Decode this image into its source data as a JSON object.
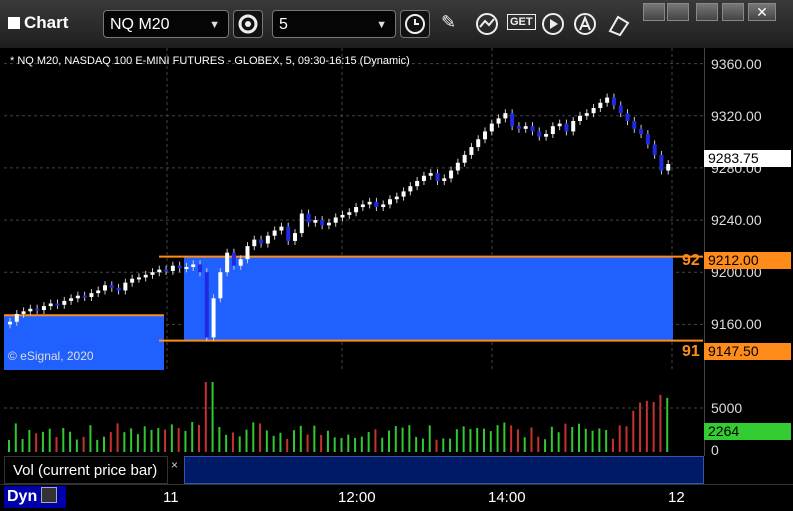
{
  "window": {
    "title": "Chart"
  },
  "toolbar": {
    "symbol_value": "NQ M20",
    "interval_value": "5",
    "get_label": "GET"
  },
  "chart": {
    "description": "* NQ M20, NASDAQ 100 E-MINI FUTURES - GLOBEX, 5, 09:30-16:15 (Dynamic)",
    "watermark": "© eSignal, 2020",
    "last_price_label": "9283.75",
    "upper_level_label": "9212.00",
    "lower_level_label": "9147.50",
    "upper_left_fragment": "92",
    "lower_left_fragment": "91",
    "volume_label": "2264",
    "volume_axis": [
      "5000",
      "0"
    ],
    "study_label": "Vol (current price bar)",
    "study_close": "×",
    "dyn_label": "Dyn",
    "time_labels": [
      "11",
      "12:00",
      "14:00",
      "12"
    ],
    "colors": {
      "up": "#ffffff",
      "down": "#1e2be0",
      "box": "#2060ff",
      "level": "#ff8c1a",
      "vol_up": "#31c831",
      "vol_down": "#c83131",
      "vol_tag": "#33cc33"
    }
  },
  "chart_data": {
    "type": "candlestick",
    "title": "* NQ M20, NASDAQ 100 E-MINI FUTURES - GLOBEX, 5, 09:30-16:15 (Dynamic)",
    "y_ticks": [
      "9360.00",
      "9320.00",
      "9280.00",
      "9240.00",
      "9200.00",
      "9160.00"
    ],
    "ylim": [
      9125,
      9372
    ],
    "x_ticks": [
      "11",
      "12:00",
      "14:00",
      "12"
    ],
    "closes": [
      9162,
      9168,
      9170,
      9172,
      9171,
      9174,
      9176,
      9175,
      9178,
      9180,
      9182,
      9181,
      9184,
      9186,
      9190,
      9188,
      9186,
      9192,
      9195,
      9196,
      9198,
      9200,
      9202,
      9201,
      9205,
      9203,
      9204,
      9206,
      9200,
      9150,
      9180,
      9200,
      9215,
      9205,
      9210,
      9220,
      9225,
      9222,
      9228,
      9232,
      9235,
      9224,
      9230,
      9245,
      9238,
      9240,
      9236,
      9238,
      9242,
      9244,
      9246,
      9250,
      9252,
      9254,
      9250,
      9252,
      9256,
      9258,
      9262,
      9266,
      9270,
      9274,
      9276,
      9270,
      9272,
      9278,
      9284,
      9290,
      9296,
      9302,
      9308,
      9314,
      9318,
      9322,
      9312,
      9310,
      9312,
      9308,
      9304,
      9306,
      9312,
      9314,
      9308,
      9316,
      9320,
      9322,
      9326,
      9330,
      9334,
      9328,
      9322,
      9316,
      9310,
      9306,
      9298,
      9290,
      9278,
      9283
    ],
    "levels": [
      9212.0,
      9147.5
    ],
    "last": 9283.75,
    "volume_ticks": [
      "5000",
      "0"
    ],
    "volume_last": 2264
  }
}
